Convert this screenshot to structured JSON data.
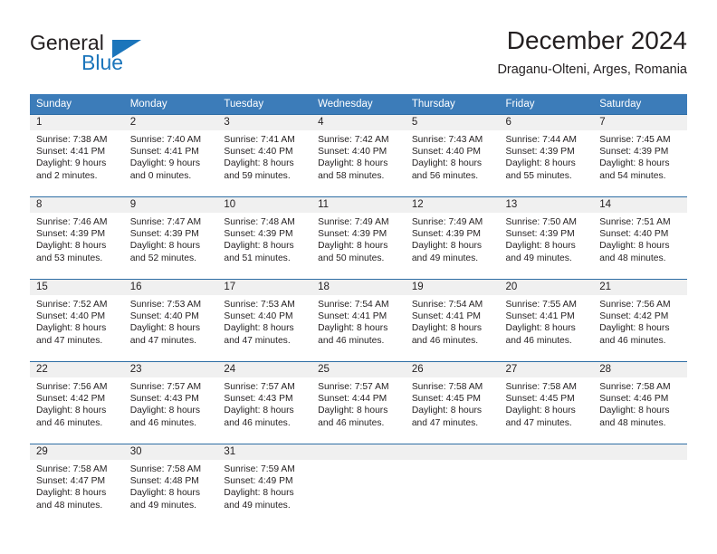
{
  "brand": {
    "name_part1": "General",
    "name_part2": "Blue",
    "logo_icon": "triangle-logo-icon",
    "accent_color": "#1b75bb"
  },
  "header": {
    "title": "December 2024",
    "location": "Draganu-Olteni, Arges, Romania"
  },
  "theme": {
    "header_row_bg": "#3c7cb9",
    "row_border": "#2e6da4",
    "daynum_band_bg": "#f0f0f0",
    "text": "#231f20"
  },
  "calendar": {
    "weekday_headers": [
      "Sunday",
      "Monday",
      "Tuesday",
      "Wednesday",
      "Thursday",
      "Friday",
      "Saturday"
    ],
    "weeks": [
      [
        {
          "day": "1",
          "sunrise": "Sunrise: 7:38 AM",
          "sunset": "Sunset: 4:41 PM",
          "daylight1": "Daylight: 9 hours",
          "daylight2": "and 2 minutes."
        },
        {
          "day": "2",
          "sunrise": "Sunrise: 7:40 AM",
          "sunset": "Sunset: 4:41 PM",
          "daylight1": "Daylight: 9 hours",
          "daylight2": "and 0 minutes."
        },
        {
          "day": "3",
          "sunrise": "Sunrise: 7:41 AM",
          "sunset": "Sunset: 4:40 PM",
          "daylight1": "Daylight: 8 hours",
          "daylight2": "and 59 minutes."
        },
        {
          "day": "4",
          "sunrise": "Sunrise: 7:42 AM",
          "sunset": "Sunset: 4:40 PM",
          "daylight1": "Daylight: 8 hours",
          "daylight2": "and 58 minutes."
        },
        {
          "day": "5",
          "sunrise": "Sunrise: 7:43 AM",
          "sunset": "Sunset: 4:40 PM",
          "daylight1": "Daylight: 8 hours",
          "daylight2": "and 56 minutes."
        },
        {
          "day": "6",
          "sunrise": "Sunrise: 7:44 AM",
          "sunset": "Sunset: 4:39 PM",
          "daylight1": "Daylight: 8 hours",
          "daylight2": "and 55 minutes."
        },
        {
          "day": "7",
          "sunrise": "Sunrise: 7:45 AM",
          "sunset": "Sunset: 4:39 PM",
          "daylight1": "Daylight: 8 hours",
          "daylight2": "and 54 minutes."
        }
      ],
      [
        {
          "day": "8",
          "sunrise": "Sunrise: 7:46 AM",
          "sunset": "Sunset: 4:39 PM",
          "daylight1": "Daylight: 8 hours",
          "daylight2": "and 53 minutes."
        },
        {
          "day": "9",
          "sunrise": "Sunrise: 7:47 AM",
          "sunset": "Sunset: 4:39 PM",
          "daylight1": "Daylight: 8 hours",
          "daylight2": "and 52 minutes."
        },
        {
          "day": "10",
          "sunrise": "Sunrise: 7:48 AM",
          "sunset": "Sunset: 4:39 PM",
          "daylight1": "Daylight: 8 hours",
          "daylight2": "and 51 minutes."
        },
        {
          "day": "11",
          "sunrise": "Sunrise: 7:49 AM",
          "sunset": "Sunset: 4:39 PM",
          "daylight1": "Daylight: 8 hours",
          "daylight2": "and 50 minutes."
        },
        {
          "day": "12",
          "sunrise": "Sunrise: 7:49 AM",
          "sunset": "Sunset: 4:39 PM",
          "daylight1": "Daylight: 8 hours",
          "daylight2": "and 49 minutes."
        },
        {
          "day": "13",
          "sunrise": "Sunrise: 7:50 AM",
          "sunset": "Sunset: 4:39 PM",
          "daylight1": "Daylight: 8 hours",
          "daylight2": "and 49 minutes."
        },
        {
          "day": "14",
          "sunrise": "Sunrise: 7:51 AM",
          "sunset": "Sunset: 4:40 PM",
          "daylight1": "Daylight: 8 hours",
          "daylight2": "and 48 minutes."
        }
      ],
      [
        {
          "day": "15",
          "sunrise": "Sunrise: 7:52 AM",
          "sunset": "Sunset: 4:40 PM",
          "daylight1": "Daylight: 8 hours",
          "daylight2": "and 47 minutes."
        },
        {
          "day": "16",
          "sunrise": "Sunrise: 7:53 AM",
          "sunset": "Sunset: 4:40 PM",
          "daylight1": "Daylight: 8 hours",
          "daylight2": "and 47 minutes."
        },
        {
          "day": "17",
          "sunrise": "Sunrise: 7:53 AM",
          "sunset": "Sunset: 4:40 PM",
          "daylight1": "Daylight: 8 hours",
          "daylight2": "and 47 minutes."
        },
        {
          "day": "18",
          "sunrise": "Sunrise: 7:54 AM",
          "sunset": "Sunset: 4:41 PM",
          "daylight1": "Daylight: 8 hours",
          "daylight2": "and 46 minutes."
        },
        {
          "day": "19",
          "sunrise": "Sunrise: 7:54 AM",
          "sunset": "Sunset: 4:41 PM",
          "daylight1": "Daylight: 8 hours",
          "daylight2": "and 46 minutes."
        },
        {
          "day": "20",
          "sunrise": "Sunrise: 7:55 AM",
          "sunset": "Sunset: 4:41 PM",
          "daylight1": "Daylight: 8 hours",
          "daylight2": "and 46 minutes."
        },
        {
          "day": "21",
          "sunrise": "Sunrise: 7:56 AM",
          "sunset": "Sunset: 4:42 PM",
          "daylight1": "Daylight: 8 hours",
          "daylight2": "and 46 minutes."
        }
      ],
      [
        {
          "day": "22",
          "sunrise": "Sunrise: 7:56 AM",
          "sunset": "Sunset: 4:42 PM",
          "daylight1": "Daylight: 8 hours",
          "daylight2": "and 46 minutes."
        },
        {
          "day": "23",
          "sunrise": "Sunrise: 7:57 AM",
          "sunset": "Sunset: 4:43 PM",
          "daylight1": "Daylight: 8 hours",
          "daylight2": "and 46 minutes."
        },
        {
          "day": "24",
          "sunrise": "Sunrise: 7:57 AM",
          "sunset": "Sunset: 4:43 PM",
          "daylight1": "Daylight: 8 hours",
          "daylight2": "and 46 minutes."
        },
        {
          "day": "25",
          "sunrise": "Sunrise: 7:57 AM",
          "sunset": "Sunset: 4:44 PM",
          "daylight1": "Daylight: 8 hours",
          "daylight2": "and 46 minutes."
        },
        {
          "day": "26",
          "sunrise": "Sunrise: 7:58 AM",
          "sunset": "Sunset: 4:45 PM",
          "daylight1": "Daylight: 8 hours",
          "daylight2": "and 47 minutes."
        },
        {
          "day": "27",
          "sunrise": "Sunrise: 7:58 AM",
          "sunset": "Sunset: 4:45 PM",
          "daylight1": "Daylight: 8 hours",
          "daylight2": "and 47 minutes."
        },
        {
          "day": "28",
          "sunrise": "Sunrise: 7:58 AM",
          "sunset": "Sunset: 4:46 PM",
          "daylight1": "Daylight: 8 hours",
          "daylight2": "and 48 minutes."
        }
      ],
      [
        {
          "day": "29",
          "sunrise": "Sunrise: 7:58 AM",
          "sunset": "Sunset: 4:47 PM",
          "daylight1": "Daylight: 8 hours",
          "daylight2": "and 48 minutes."
        },
        {
          "day": "30",
          "sunrise": "Sunrise: 7:58 AM",
          "sunset": "Sunset: 4:48 PM",
          "daylight1": "Daylight: 8 hours",
          "daylight2": "and 49 minutes."
        },
        {
          "day": "31",
          "sunrise": "Sunrise: 7:59 AM",
          "sunset": "Sunset: 4:49 PM",
          "daylight1": "Daylight: 8 hours",
          "daylight2": "and 49 minutes."
        },
        {
          "day": "",
          "sunrise": "",
          "sunset": "",
          "daylight1": "",
          "daylight2": ""
        },
        {
          "day": "",
          "sunrise": "",
          "sunset": "",
          "daylight1": "",
          "daylight2": ""
        },
        {
          "day": "",
          "sunrise": "",
          "sunset": "",
          "daylight1": "",
          "daylight2": ""
        },
        {
          "day": "",
          "sunrise": "",
          "sunset": "",
          "daylight1": "",
          "daylight2": ""
        }
      ]
    ]
  }
}
